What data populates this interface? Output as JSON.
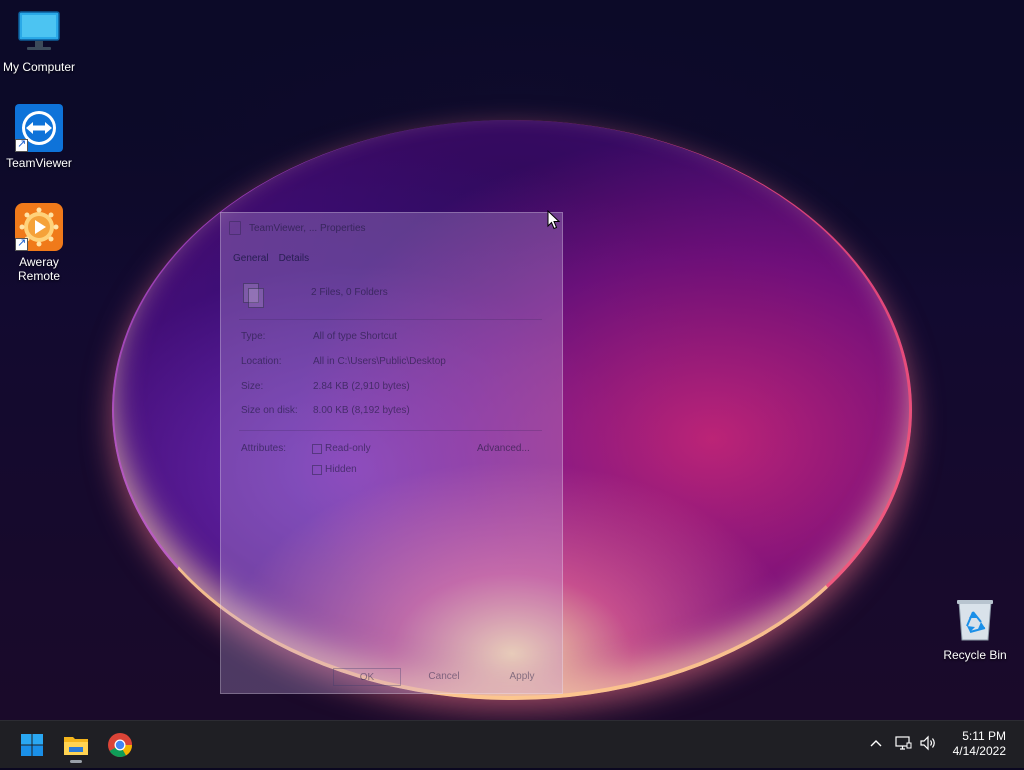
{
  "desktop": {
    "icons": [
      {
        "name": "My Computer"
      },
      {
        "name": "TeamViewer"
      },
      {
        "name": "Aweray Remote"
      },
      {
        "name": "Recycle Bin"
      }
    ]
  },
  "dialog": {
    "title": "TeamViewer, ... Properties",
    "tabs": [
      "General",
      "Details"
    ],
    "summary": "2 Files, 0 Folders",
    "properties": [
      {
        "label": "Type:",
        "value": "All of type Shortcut"
      },
      {
        "label": "Location:",
        "value": "All in C:\\Users\\Public\\Desktop"
      },
      {
        "label": "Size:",
        "value": "2.84 KB (2,910 bytes)"
      },
      {
        "label": "Size on disk:",
        "value": "8.00 KB (8,192 bytes)"
      }
    ],
    "attributes_label": "Attributes:",
    "attributes": [
      {
        "label": "Read-only",
        "checked": false
      },
      {
        "label": "Hidden",
        "checked": false
      }
    ],
    "advanced_label": "Advanced...",
    "buttons": {
      "ok": "OK",
      "cancel": "Cancel",
      "apply": "Apply"
    }
  },
  "taskbar": {
    "pinned": [
      "start-icon",
      "file-explorer-icon",
      "chrome-icon"
    ],
    "tray": [
      "chevron-up-icon",
      "network-icon",
      "volume-icon"
    ],
    "time": "5:11 PM",
    "date": "4/14/2022"
  },
  "colors": {
    "taskbar_bg": "#1f1f24",
    "accent_blue": "#1a8fe8"
  }
}
